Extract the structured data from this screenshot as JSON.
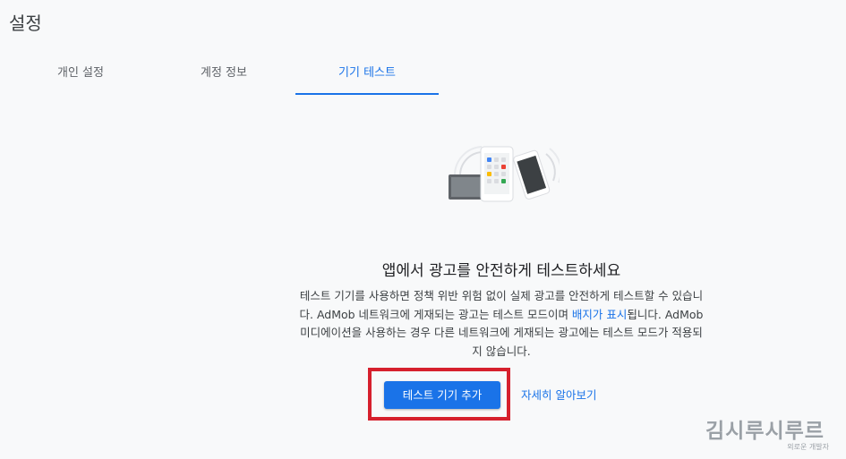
{
  "page": {
    "title": "설정"
  },
  "tabs": [
    {
      "label": "개인 설정",
      "active": false
    },
    {
      "label": "계정 정보",
      "active": false
    },
    {
      "label": "기기 테스트",
      "active": true
    }
  ],
  "content": {
    "heading": "앱에서 광고를 안전하게 테스트하세요",
    "desc_part1": "테스트 기기를 사용하면 정책 위반 위험 없이 실제 광고를 안전하게 테스트할 수 있습니다. AdMob 네트워크에 게재되는 광고는 테스트 모드이며 ",
    "desc_link": "배지가 표시",
    "desc_part2": "됩니다. AdMob 미디에이션을 사용하는 경우 다른 네트워크에 게재되는 광고에는 테스트 모드가 적용되지 않습니다.",
    "add_button": "테스트 기기 추가",
    "learn_more": "자세히 알아보기"
  },
  "watermark": {
    "main": "김시루시루르",
    "sub": "외로운 개발자"
  },
  "colors": {
    "accent": "#1a73e8",
    "highlight": "#d6202d",
    "background": "#f8f9fa"
  },
  "icons": {
    "illustration": "devices-illustration"
  }
}
